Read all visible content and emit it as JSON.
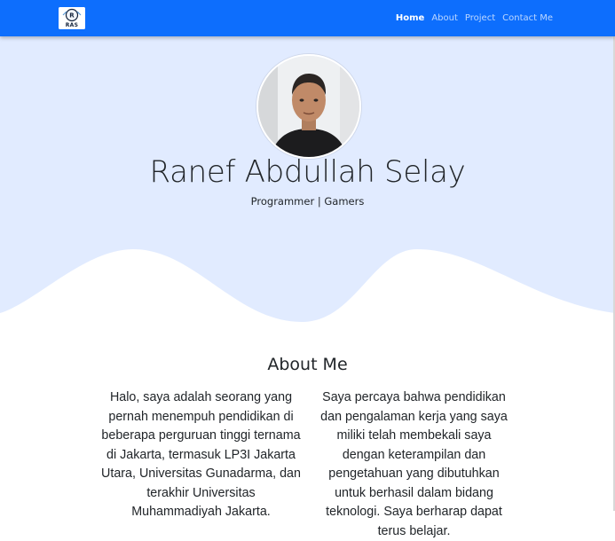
{
  "brand": {
    "logo_text": "RAS"
  },
  "nav": {
    "items": [
      "Home",
      "About",
      "Project",
      "Contact Me"
    ],
    "active": "Home"
  },
  "hero": {
    "name": "Ranef Abdullah Selay",
    "role": "Programmer | Gamers"
  },
  "about": {
    "title": "About Me",
    "col_left": "Halo, saya adalah seorang yang pernah menempuh pendidikan di beberapa perguruan tinggi ternama di Jakarta, termasuk LP3I Jakarta Utara, Universitas Gunadarma, dan terakhir Universitas Muhammadiyah Jakarta.",
    "col_right": "Saya percaya bahwa pendidikan dan pengalaman kerja yang saya miliki telah membekali saya dengan keterampilan dan pengetahuan yang dibutuhkan untuk berhasil dalam bidang teknologi. Saya berharap dapat terus belajar."
  },
  "colors": {
    "navbar": "#0d6efd",
    "hero_bg": "#e1ebff",
    "wave": "#ffffff",
    "text": "#212529"
  }
}
